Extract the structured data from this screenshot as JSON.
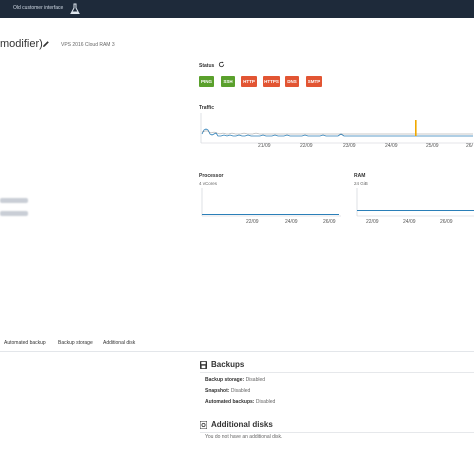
{
  "topbar": {
    "link": "Old customer interface",
    "flask_icon": "flask-icon"
  },
  "header": {
    "title": "modifier)",
    "subtitle": "VPS 2016 Cloud RAM 3",
    "edit_icon": "pencil-icon"
  },
  "status": {
    "label": "Status",
    "refresh_icon": "refresh-icon",
    "badges": [
      {
        "label": "PING",
        "color": "#5aa02c"
      },
      {
        "label": "SSH",
        "color": "#5aa02c"
      },
      {
        "label": "HTTP",
        "color": "#e25533"
      },
      {
        "label": "HTTPS",
        "color": "#e25533"
      },
      {
        "label": "DNS",
        "color": "#e25533"
      },
      {
        "label": "SMTP",
        "color": "#e25533"
      }
    ]
  },
  "traffic": {
    "label": "Traffic",
    "ticks": [
      "21/09",
      "22/09",
      "23/09",
      "24/09",
      "25/09",
      "26/"
    ]
  },
  "processor": {
    "label": "Processor",
    "sub": "4 vCores",
    "ticks": [
      "22/09",
      "24/09",
      "26/09"
    ]
  },
  "ram": {
    "label": "RAM",
    "sub": "24 GiB",
    "ticks": [
      "22/09",
      "24/09",
      "26/09"
    ]
  },
  "tabs": [
    "Automated backup",
    "Backup storage",
    "Additional disk"
  ],
  "backups": {
    "icon": "save-icon",
    "title": "Backups",
    "rows": [
      {
        "key": "Backup storage:",
        "value": "Disabled"
      },
      {
        "key": "Snapshot:",
        "value": "Disabled"
      },
      {
        "key": "Automated backups:",
        "value": "Disabled"
      }
    ]
  },
  "disks": {
    "icon": "disk-icon",
    "title": "Additional disks",
    "message": "You do not have an additional disk."
  },
  "colors": {
    "topbar": "#1e2a3a",
    "line": "#2b7fb8",
    "spike": "#f0a800"
  }
}
